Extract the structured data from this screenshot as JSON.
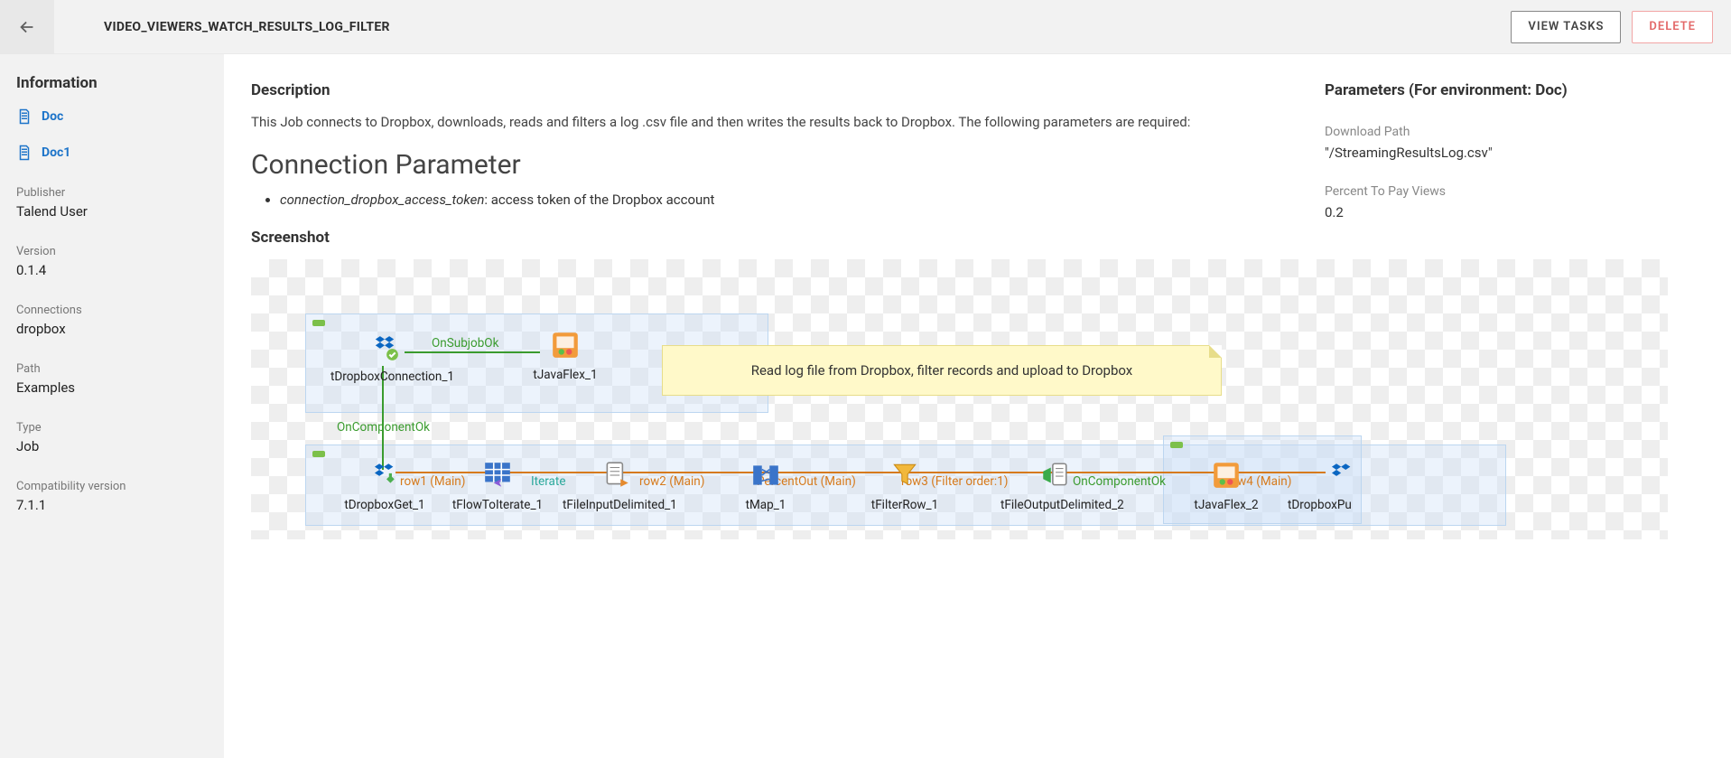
{
  "topbar": {
    "title": "VIDEO_VIEWERS_WATCH_RESULTS_LOG_FILTER",
    "view_tasks": "VIEW TASKS",
    "delete": "DELETE"
  },
  "sidebar": {
    "heading": "Information",
    "docs": [
      "Doc",
      "Doc1"
    ],
    "info": [
      {
        "label": "Publisher",
        "value": "Talend User"
      },
      {
        "label": "Version",
        "value": "0.1.4"
      },
      {
        "label": "Connections",
        "value": "dropbox"
      },
      {
        "label": "Path",
        "value": "Examples"
      },
      {
        "label": "Type",
        "value": "Job"
      },
      {
        "label": "Compatibility version",
        "value": "7.1.1"
      }
    ]
  },
  "main": {
    "description_heading": "Description",
    "description_text": "This Job connects to Dropbox, downloads, reads and filters a log .csv file and then writes the results back to Dropbox. The following parameters are required:",
    "conn_param_heading": "Connection Parameter",
    "conn_param_item_key": "connection_dropbox_access_token",
    "conn_param_item_rest": ": access token of the Dropbox account",
    "screenshot_heading": "Screenshot"
  },
  "params": {
    "heading": "Parameters (For environment: Doc)",
    "list": [
      {
        "label": "Download Path",
        "value": "\"/StreamingResultsLog.csv\""
      },
      {
        "label": "Percent To Pay Views",
        "value": "0.2"
      }
    ]
  },
  "canvas": {
    "note": "Read log file from Dropbox, filter records and upload to Dropbox",
    "links": {
      "onSubjobOk": "OnSubjobOk",
      "onComponentOk": "OnComponentOk",
      "onComponentOk2": "OnComponentOk",
      "row1": "row1 (Main)",
      "iterate": "Iterate",
      "row2": "row2 (Main)",
      "percentOut": "PercentOut (Main)",
      "row3": "row3 (Filter order:1)",
      "row4": "row4 (Main)"
    },
    "nodes": {
      "dconn": "tDropboxConnection_1",
      "jflex1": "tJavaFlex_1",
      "dget1": "tDropboxGet_1",
      "flow": "tFlowToIterate_1",
      "fileIn": "tFileInputDelimited_1",
      "tmap": "tMap_1",
      "filter": "tFilterRow_1",
      "fileOut": "tFileOutputDelimited_2",
      "jflex2": "tJavaFlex_2",
      "dput": "tDropboxPu"
    }
  }
}
